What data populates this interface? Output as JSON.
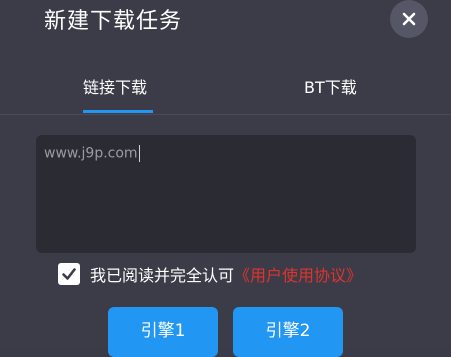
{
  "dialog": {
    "title": "新建下载任务",
    "close_icon": "close-icon"
  },
  "tabs": [
    {
      "label": "链接下载",
      "active": true
    },
    {
      "label": "BT下载",
      "active": false
    }
  ],
  "url_input": {
    "value": "www.j9p.com"
  },
  "agreement": {
    "checked": true,
    "text": "我已阅读并完全认可",
    "link": "《用户使用协议》"
  },
  "buttons": {
    "engine1": "引擎1",
    "engine2": "引擎2"
  },
  "colors": {
    "accent": "#2196f3",
    "link": "#e0332e",
    "background": "#3b3c48",
    "input_bg": "#2a2b33"
  }
}
